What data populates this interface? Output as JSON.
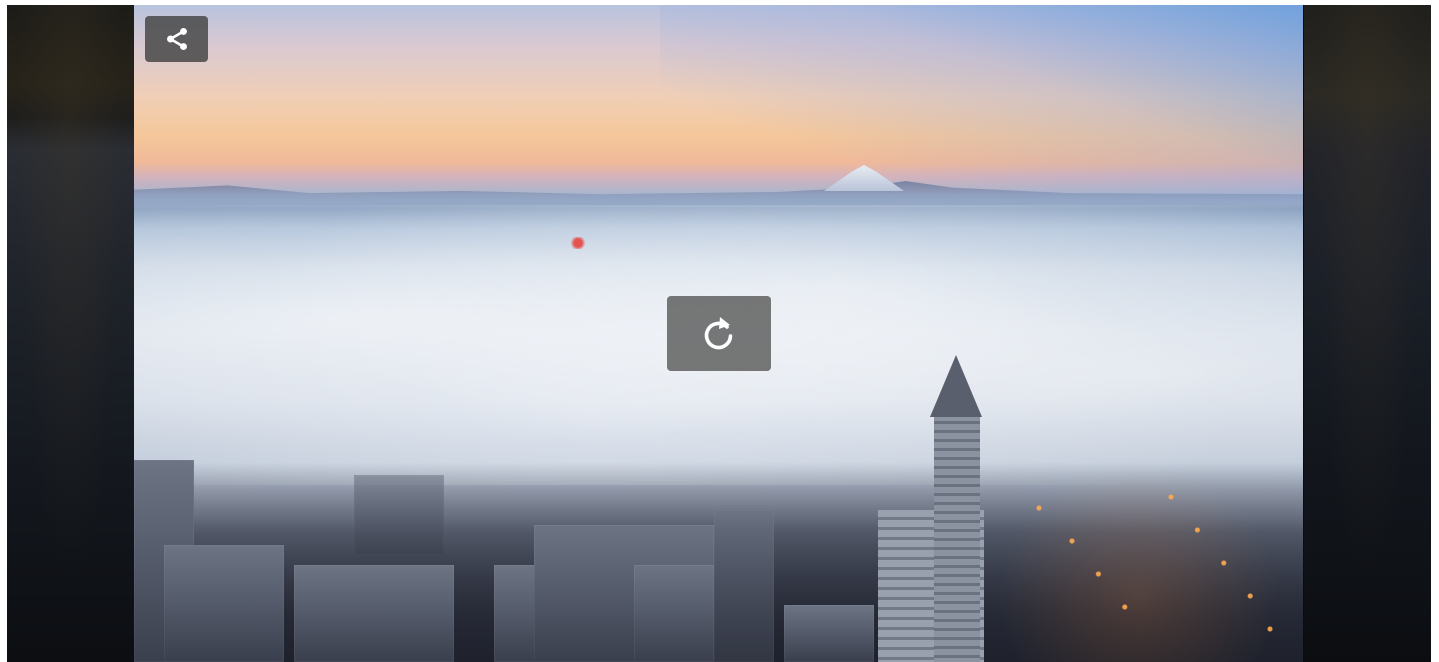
{
  "player": {
    "share_button": {
      "icon": "share-icon"
    },
    "replay_button": {
      "icon": "replay-icon"
    }
  },
  "colors": {
    "control_background": "#484848",
    "icon": "#ffffff"
  }
}
